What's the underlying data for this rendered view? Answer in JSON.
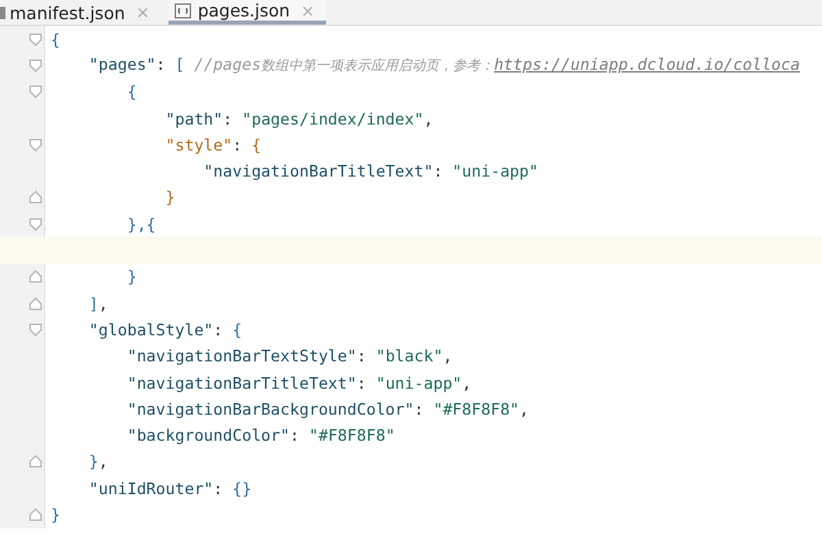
{
  "tabs": [
    {
      "label": "manifest.json",
      "selected": false,
      "close": "×"
    },
    {
      "label": "pages.json",
      "selected": true,
      "close": "×"
    }
  ],
  "lines": [
    {
      "fold_start": true,
      "tokens": [
        {
          "kind": "brace",
          "text": "{"
        }
      ]
    },
    {
      "fold_start": true,
      "tokens": [
        {
          "kind": "key",
          "text": "    \"pages\""
        },
        {
          "kind": "punct",
          "text": ": "
        },
        {
          "kind": "brace",
          "text": "["
        },
        {
          "kind": "comment",
          "text": " //pages"
        },
        {
          "kind": "cjk",
          "text": "数组中第一项表示应用启动页，参考："
        },
        {
          "kind": "link",
          "text": "https://uniapp.dcloud.io/colloca"
        }
      ]
    },
    {
      "fold_start": true,
      "tokens": [
        {
          "kind": "brace",
          "text": "        {"
        }
      ]
    },
    {
      "tokens": [
        {
          "kind": "key",
          "text": "            \"path\""
        },
        {
          "kind": "punct",
          "text": ": "
        },
        {
          "kind": "string",
          "text": "\"pages/index/index\""
        },
        {
          "kind": "punct",
          "text": ","
        }
      ]
    },
    {
      "fold_start": true,
      "tokens": [
        {
          "kind": "match",
          "text": "            \"style\""
        },
        {
          "kind": "punct",
          "text": ": "
        },
        {
          "kind": "match",
          "text": "{"
        }
      ]
    },
    {
      "tokens": [
        {
          "kind": "key",
          "text": "                \"navigationBarTitleText\""
        },
        {
          "kind": "punct",
          "text": ": "
        },
        {
          "kind": "string",
          "text": "\"uni-app\""
        }
      ]
    },
    {
      "fold_end": true,
      "tokens": [
        {
          "kind": "match",
          "text": "            }"
        }
      ]
    },
    {
      "fold_start": true,
      "tokens": [
        {
          "kind": "brace",
          "text": "        },{"
        }
      ]
    },
    {
      "current": true
    },
    {
      "fold_end": true,
      "tokens": [
        {
          "kind": "brace",
          "text": "        }"
        }
      ]
    },
    {
      "fold_end": true,
      "tokens": [
        {
          "kind": "brace",
          "text": "    ]"
        },
        {
          "kind": "punct",
          "text": ","
        }
      ]
    },
    {
      "fold_start": true,
      "tokens": [
        {
          "kind": "key",
          "text": "    \"globalStyle\""
        },
        {
          "kind": "punct",
          "text": ": "
        },
        {
          "kind": "brace",
          "text": "{"
        }
      ]
    },
    {
      "tokens": [
        {
          "kind": "key",
          "text": "        \"navigationBarTextStyle\""
        },
        {
          "kind": "punct",
          "text": ": "
        },
        {
          "kind": "string",
          "text": "\"black\""
        },
        {
          "kind": "punct",
          "text": ","
        }
      ]
    },
    {
      "tokens": [
        {
          "kind": "key",
          "text": "        \"navigationBarTitleText\""
        },
        {
          "kind": "punct",
          "text": ": "
        },
        {
          "kind": "string",
          "text": "\"uni-app\""
        },
        {
          "kind": "punct",
          "text": ","
        }
      ]
    },
    {
      "tokens": [
        {
          "kind": "key",
          "text": "        \"navigationBarBackgroundColor\""
        },
        {
          "kind": "punct",
          "text": ": "
        },
        {
          "kind": "string",
          "text": "\"#F8F8F8\""
        },
        {
          "kind": "punct",
          "text": ","
        }
      ]
    },
    {
      "tokens": [
        {
          "kind": "key",
          "text": "        \"backgroundColor\""
        },
        {
          "kind": "punct",
          "text": ": "
        },
        {
          "kind": "string",
          "text": "\"#F8F8F8\""
        }
      ]
    },
    {
      "fold_end": true,
      "tokens": [
        {
          "kind": "brace",
          "text": "    }"
        },
        {
          "kind": "punct",
          "text": ","
        }
      ]
    },
    {
      "tokens": [
        {
          "kind": "key",
          "text": "    \"uniIdRouter\""
        },
        {
          "kind": "punct",
          "text": ": "
        },
        {
          "kind": "brace",
          "text": "{}"
        }
      ]
    },
    {
      "fold_end": true,
      "tokens": [
        {
          "kind": "brace",
          "text": "}"
        }
      ]
    }
  ]
}
